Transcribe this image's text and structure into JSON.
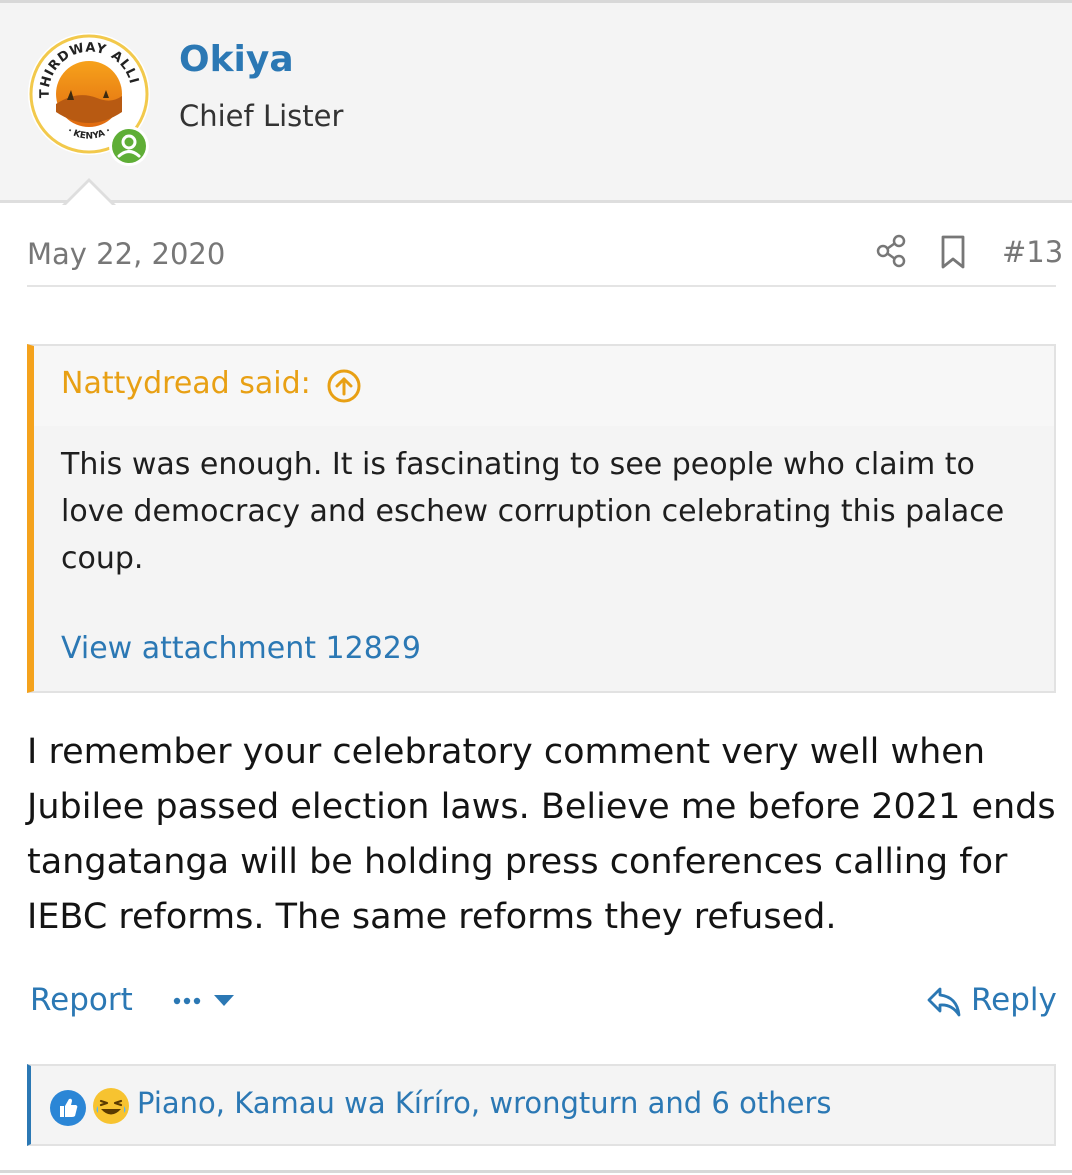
{
  "user": {
    "name": "Okiya",
    "title": "Chief Lister",
    "avatar_text_top": "THIRDWAY ALLIANCE",
    "avatar_text_bottom": "· KENYA ·",
    "online_status": "online"
  },
  "post": {
    "date": "May 22, 2020",
    "number": "#13"
  },
  "quote": {
    "author": "Nattydread said:",
    "body": "This was enough. It is fascinating to see people who claim to love democracy and eschew corruption celebrating this palace coup.",
    "attachment": "View attachment 12829"
  },
  "message": {
    "body": "I remember your celebratory comment very well when Jubilee passed election laws. Believe me before 2021 ends tangatanga will be holding press conferences calling for IEBC reforms. The same reforms they refused."
  },
  "actions": {
    "report": "Report",
    "reply": "Reply"
  },
  "reactions": {
    "users": "Piano, Kamau wa Kíríro, wrongturn and 6 others",
    "icons": [
      "like-icon",
      "laugh-icon"
    ]
  },
  "colors": {
    "link": "#2b78b4",
    "quote_accent": "#f4a21c",
    "online": "#5fae36"
  }
}
